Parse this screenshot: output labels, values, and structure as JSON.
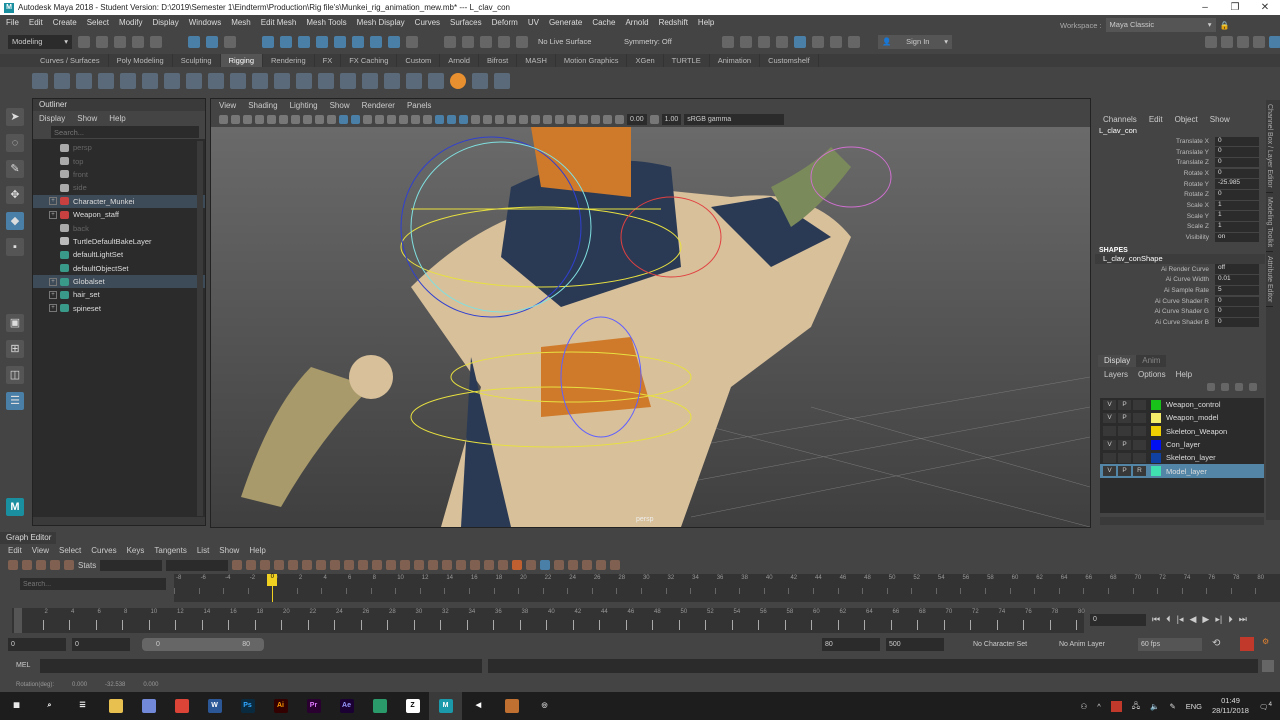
{
  "title": "Autodesk Maya 2018 - Student Version: D:\\2019\\Semester 1\\Eindterm\\Production\\Rig file's\\Munkei_rig_animation_mew.mb*  ---  L_clav_con",
  "menubar": [
    "File",
    "Edit",
    "Create",
    "Select",
    "Modify",
    "Display",
    "Windows",
    "Mesh",
    "Edit Mesh",
    "Mesh Tools",
    "Mesh Display",
    "Curves",
    "Surfaces",
    "Deform",
    "UV",
    "Generate",
    "Cache",
    "Arnold",
    "Redshift",
    "Help"
  ],
  "status": {
    "mode": "Modeling",
    "live_surface": "No Live Surface",
    "symmetry": "Symmetry: Off",
    "sign_in": "Sign In",
    "workspace_label": "Workspace :",
    "workspace": "Maya Classic"
  },
  "shelf_tabs": [
    "Curves / Surfaces",
    "Poly Modeling",
    "Sculpting",
    "Rigging",
    "Rendering",
    "FX",
    "FX Caching",
    "Custom",
    "Arnold",
    "Bifrost",
    "MASH",
    "Motion Graphics",
    "XGen",
    "TURTLE",
    "Animation",
    "Customshelf"
  ],
  "shelf_active": "Rigging",
  "outliner": {
    "title": "Outliner",
    "menu": [
      "Display",
      "Show",
      "Help"
    ],
    "search_placeholder": "Search...",
    "items": [
      {
        "label": "persp",
        "dim": true,
        "exp": false,
        "color": "#aaa"
      },
      {
        "label": "top",
        "dim": true,
        "exp": false,
        "color": "#aaa"
      },
      {
        "label": "front",
        "dim": true,
        "exp": false,
        "color": "#aaa"
      },
      {
        "label": "side",
        "dim": true,
        "exp": false,
        "color": "#aaa"
      },
      {
        "label": "Character_Munkei",
        "exp": true,
        "hl": true,
        "color": "#c84040"
      },
      {
        "label": "Weapon_staff",
        "exp": true,
        "color": "#c84040"
      },
      {
        "label": "back",
        "dim": true,
        "exp": false,
        "color": "#aaa"
      },
      {
        "label": "TurtleDefaultBakeLayer",
        "exp": false,
        "color": "#bbb"
      },
      {
        "label": "defaultLightSet",
        "exp": false,
        "color": "#3a9a8a"
      },
      {
        "label": "defaultObjectSet",
        "exp": false,
        "color": "#3a9a8a"
      },
      {
        "label": "Globalset",
        "exp": true,
        "hl": true,
        "color": "#3a9a8a"
      },
      {
        "label": "hair_set",
        "exp": true,
        "color": "#3a9a8a"
      },
      {
        "label": "spineset",
        "exp": true,
        "color": "#3a9a8a"
      }
    ]
  },
  "viewport": {
    "menu": [
      "View",
      "Shading",
      "Lighting",
      "Show",
      "Renderer",
      "Panels"
    ],
    "exposure": "0.00",
    "gamma": "1.00",
    "color_space": "sRGB gamma",
    "camera": "persp"
  },
  "channel_box": {
    "menu": [
      "Channels",
      "Edit",
      "Object",
      "Show"
    ],
    "object": "L_clav_con",
    "channels": [
      [
        "Translate X",
        "0"
      ],
      [
        "Translate Y",
        "0"
      ],
      [
        "Translate Z",
        "0"
      ],
      [
        "Rotate X",
        "0"
      ],
      [
        "Rotate Y",
        "-25.985"
      ],
      [
        "Rotate Z",
        "0"
      ],
      [
        "Scale X",
        "1"
      ],
      [
        "Scale Y",
        "1"
      ],
      [
        "Scale Z",
        "1"
      ],
      [
        "Visibility",
        "on"
      ]
    ],
    "shapes_label": "SHAPES",
    "shape": "L_clav_conShape",
    "shape_channels": [
      [
        "Ai Render Curve",
        "off"
      ],
      [
        "Ai Curve Width",
        "0.01"
      ],
      [
        "Ai Sample Rate",
        "5"
      ],
      [
        "Ai Curve Shader R",
        "0"
      ],
      [
        "Ai Curve Shader G",
        "0"
      ],
      [
        "Ai Curve Shader B",
        "0"
      ]
    ]
  },
  "side_tabs": [
    "Channel Box / Layer Editor",
    "Modeling Toolkit",
    "Attribute Editor"
  ],
  "layers": {
    "tabs": [
      "Display",
      "Anim"
    ],
    "menu": [
      "Layers",
      "Options",
      "Help"
    ],
    "rows": [
      {
        "v": "V",
        "p": "P",
        "r": "",
        "name": "Weapon_control",
        "color": "#19c219"
      },
      {
        "v": "V",
        "p": "P",
        "r": "",
        "name": "Weapon_model",
        "color": "#f5ee6a"
      },
      {
        "v": "",
        "p": "",
        "r": "",
        "name": "Skeleton_Weapon",
        "color": "#f0d000"
      },
      {
        "v": "V",
        "p": "P",
        "r": "",
        "name": "Con_layer",
        "color": "#0010f0"
      },
      {
        "v": "",
        "p": "",
        "r": "",
        "name": "Skeleton_layer",
        "color": "#1040a0"
      },
      {
        "v": "V",
        "p": "P",
        "r": "R",
        "name": "Model_layer",
        "color": "#40e0b0",
        "sel": true
      }
    ]
  },
  "graph_editor": {
    "title": "Graph Editor",
    "menu": [
      "Edit",
      "View",
      "Select",
      "Curves",
      "Keys",
      "Tangents",
      "List",
      "Show",
      "Help"
    ],
    "stats_label": "Stats",
    "search_placeholder": "Search...",
    "ruler_start": -8,
    "ruler_end": 82,
    "current": "0"
  },
  "timeline": {
    "start": 0,
    "end": 80,
    "current_frame": "0"
  },
  "range": {
    "start": "0",
    "anim_start": "0",
    "range_start": "0",
    "range_end": "80",
    "end": "80",
    "anim_end": "500",
    "character_set": "No Character Set",
    "anim_layer": "No Anim Layer",
    "fps": "60 fps"
  },
  "mel": {
    "label": "MEL"
  },
  "helpline": [
    "Rotation(deg):",
    "0.000",
    "-32.538",
    "0.000"
  ],
  "taskbar": {
    "apps": [
      {
        "t": "▦",
        "bg": "#1d1d1d",
        "fg": "#fff"
      },
      {
        "t": "⌕",
        "bg": "#1d1d1d",
        "fg": "#fff"
      },
      {
        "t": "☰",
        "bg": "#1d1d1d",
        "fg": "#fff"
      },
      {
        "t": "",
        "bg": "#e8c050",
        "fg": "#000"
      },
      {
        "t": "",
        "bg": "#7289da",
        "fg": "#fff"
      },
      {
        "t": "",
        "bg": "#db4437",
        "fg": "#fff"
      },
      {
        "t": "W",
        "bg": "#2b5797",
        "fg": "#fff"
      },
      {
        "t": "Ps",
        "bg": "#0a2a40",
        "fg": "#31a8ff"
      },
      {
        "t": "Ai",
        "bg": "#330000",
        "fg": "#ff9a00"
      },
      {
        "t": "Pr",
        "bg": "#2a0030",
        "fg": "#e077ff"
      },
      {
        "t": "Ae",
        "bg": "#1a0033",
        "fg": "#9999ff"
      },
      {
        "t": "",
        "bg": "#2a9a6a",
        "fg": "#fff"
      },
      {
        "t": "Z",
        "bg": "#fff",
        "fg": "#000"
      },
      {
        "t": "M",
        "bg": "#1a9aaa",
        "fg": "#fff"
      },
      {
        "t": "◀",
        "bg": "#1d1d1d",
        "fg": "#fff"
      },
      {
        "t": "",
        "bg": "#c07030",
        "fg": "#fff"
      },
      {
        "t": "◎",
        "bg": "#1d1d1d",
        "fg": "#ccc"
      }
    ],
    "lang": "ENG",
    "time": "01:49",
    "date": "28/11/2018",
    "notif": "4"
  }
}
